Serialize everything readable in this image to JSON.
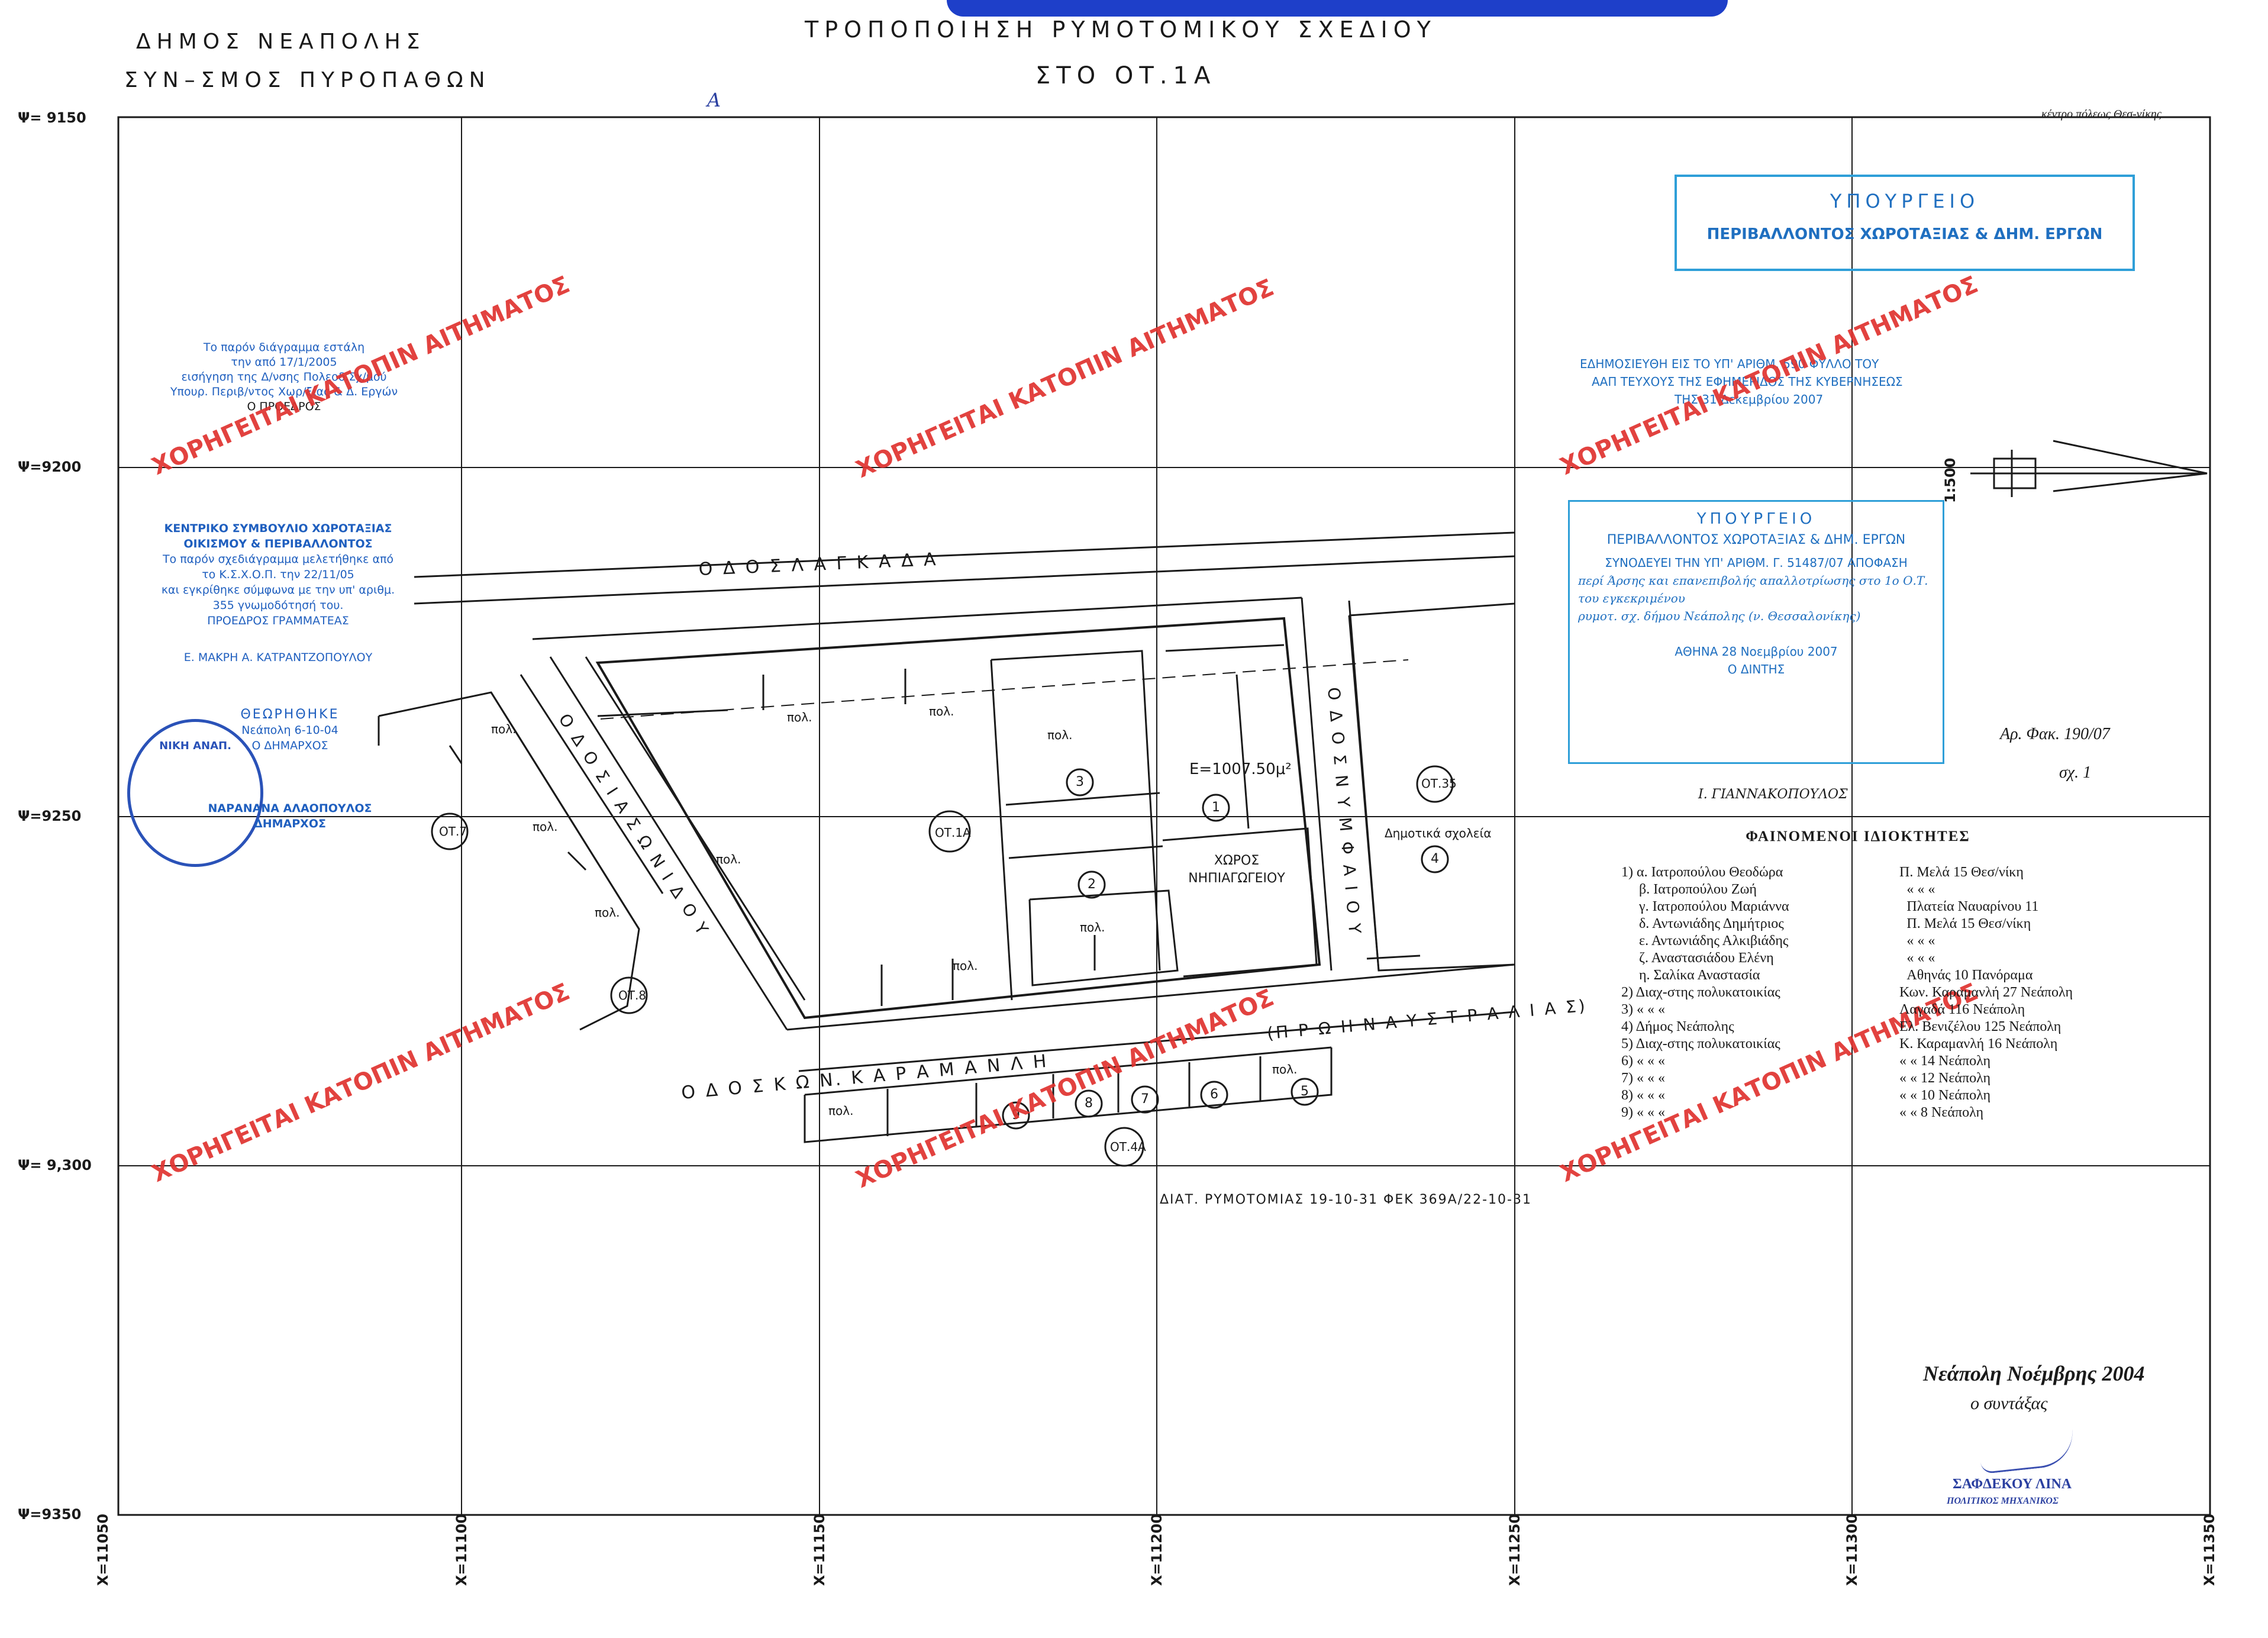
{
  "header": {
    "municipality_line1": "ΔΗΜΟΣ ΝΕΑΠΟΛΗΣ",
    "municipality_line2": "ΣΥΝ–ΣΜΟΣ ΠΥΡΟΠΑΘΩΝ",
    "title_line1": "ΤΡΟΠΟΠΟΙΗΣΗ ΡΥΜΟΤΟΜΙΚΟΥ ΣΧΕΔΙΟΥ",
    "title_line2": "ΣΤΟ ΟΤ.1Α",
    "handwritten_mark": "Α",
    "top_right_note": "κέντρο πόλεως Θεσ-νίκης"
  },
  "grid": {
    "y_labels": [
      "Ψ= 9150",
      "Ψ=9200",
      "Ψ=9250",
      "Ψ= 9,300",
      "Ψ=9350"
    ],
    "x_labels": [
      "Χ=11050",
      "Χ=11100",
      "Χ=11150",
      "Χ=11200",
      "Χ=11250",
      "Χ=11300",
      "Χ=11350"
    ],
    "scale": "1:500"
  },
  "map": {
    "streets": {
      "lagkada": "Ο Δ Ο Σ   Λ Α Γ Κ Α Δ Α",
      "iasonidou": "Ο Δ Ο Σ   Ι Α Σ Ω Ν Ι Δ Ο Υ",
      "nymfaiou": "Ο Δ Ο Σ   Ν Υ Μ Φ Α Ι Ο Υ",
      "karamanli": "Ο Δ Ο Σ   Κ Ω Ν.   Κ Α Ρ Α Μ Α Ν Λ Η",
      "former": "(Π Ρ Ω Η Ν   Α Υ Σ Τ Ρ Α Λ Ι Α Σ)"
    },
    "block_labels": [
      "ΟΤ.1Α",
      "ΟΤ.7",
      "ΟΤ.8",
      "ΟΤ.35",
      "ΟΤ.4Α"
    ],
    "pol": "πολ.",
    "area": "Ε=1007.50μ²",
    "kindergarten": "ΧΩΡΟΣ ΝΗΠΙΑΓΩΓΕΙΟΥ",
    "schools": "Δημοτικά σχολεία",
    "parcel_numbers": [
      "1",
      "2",
      "3",
      "4",
      "5",
      "6",
      "7",
      "8",
      "9"
    ],
    "diat_note": "ΔΙΑΤ. ΡΥΜΟΤΟΜΙΑΣ 19-10-31 ΦΕΚ 369Α/22-10-31"
  },
  "stamps": {
    "ministry_top": {
      "line1": "ΥΠΟΥΡΓΕΙΟ",
      "line2": "ΠΕΡΙΒΑΛΛΟΝΤΟΣ ΧΩΡΟΤΑΞΙΑΣ & ΔΗΜ. ΕΡΓΩΝ"
    },
    "ministry_mid": {
      "line1": "ΥΠΟΥΡΓΕΙΟ",
      "line2": "ΠΕΡΙΒΑΛΛΟΝΤΟΣ ΧΩΡΟΤΑΞΙΑΣ & ΔΗΜ. ΕΡΓΩΝ",
      "line3": "ΣΥΝΟΔΕΥΕΙ ΤΗΝ ΥΠ' ΑΡΙΘΜ. Γ. 51487/07 ΑΠΟΦΑΣΗ",
      "line4": "περί Άρσης και επανεπιβολής απαλλοτρίωσης στο 1ο Ο.Τ. του εγκεκριμένου",
      "line5": "ρυμοτ. σχ. δήμου Νεάπολης (ν. Θεσσαλονίκης)",
      "line6": "ΑΘΗΝΑ  28  Νοεμβρίου  2007",
      "line7": "Ο ΔΙΝΤΗΣ",
      "signer": "Ι. ΓΙΑΝΝΑΚΟΠΟΥΛΟΣ"
    },
    "publication": {
      "line1": "ΕΔΗΜΟΣΙΕΥΘΗ ΕΙΣ ΤΟ ΥΠ' ΑΡΙΘΜ.  590  ΦΥΛΛΟ ΤΟΥ",
      "line2": "ΑΑΠ  ΤΕΥΧΟΥΣ ΤΗΣ ΕΦΗΜΕΡΙΔΟΣ ΤΗΣ ΚΥΒΕΡΝΗΣΕΩΣ",
      "line3": "ΤΗΣ 31 Δεκεμβρίου 2007"
    },
    "file_ref": {
      "line1": "Αρ. Φακ. 190/07",
      "line2": "σχ. 1"
    },
    "council": {
      "line1": "ΚΕΝΤΡΙΚΟ ΣΥΜΒΟΥΛΙΟ ΧΩΡΟΤΑΞΙΑΣ",
      "line2": "ΟΙΚΙΣΜΟΥ & ΠΕΡΙΒΑΛΛΟΝΤΟΣ",
      "line3": "Το παρόν σχεδιάγραμμα μελετήθηκε από",
      "line4": "το Κ.Σ.Χ.Ο.Π. την 22/11/05",
      "line5": "και εγκρίθηκε σύμφωνα με την υπ' αριθμ.",
      "line6": "355 γνωμοδότησή του.",
      "line7": "ΠΡΟΕΔΡΟΣ          ΓΡΑΜΜΑΤΕΑΣ",
      "line8": "Ε. ΜΑΚΡΗ      Α. ΚΑΤΡΑΝΤΖΟΠΟΥΛΟΥ"
    },
    "proposal": {
      "line1": "Το παρόν διάγραμμα εστάλη",
      "line2": "την από 17/1/2005",
      "line3": "εισήγηση της Δ/νσης Πολεοδ.Σχ/μού",
      "line4": "Υπουρ. Περιβ/ντος Χωρ/ξίας & Δ. Εργών",
      "line5": "Ο ΠΡΟΕΔΡΟΣ"
    },
    "mayor": {
      "line1": "ΝΙΚΗ ΑΝΑΠ.",
      "line2": "ΘΕΩΡΗΘΗΚΕ",
      "line3": "Νεάπολη 6-10-04",
      "line4": "Ο ΔΗΜΑΡΧΟΣ",
      "line5": "ΝΑΡΑΝΑΝΑ ΑΛΑΟΠΟΥΛΟΣ",
      "line6": "ΔΗΜΑΡΧΟΣ"
    }
  },
  "watermark": "ΧΟΡΗΓΕΙΤΑΙ ΚΑΤΟΠΙΝ ΑΙΤΗΜΑΤΟΣ",
  "owners": {
    "title": "ΦΑΙΝΟΜΕΝΟΙ   ΙΔΙΟΚΤΗΤΕΣ",
    "rows": [
      {
        "name": "1) α. Ιατροπούλου Θεοδώρα",
        "addr": "Π. Μελά 15 Θεσ/νίκη"
      },
      {
        "name": "β. Ιατροπούλου Ζωή",
        "addr": "«      «      «"
      },
      {
        "name": "γ. Ιατροπούλου Μαριάννα",
        "addr": "Πλατεία Ναυαρίνου 11"
      },
      {
        "name": "δ. Αντωνιάδης Δημήτριος",
        "addr": "Π. Μελά 15 Θεσ/νίκη"
      },
      {
        "name": "ε. Αντωνιάδης Αλκιβιάδης",
        "addr": "«      «      «"
      },
      {
        "name": "ζ. Αναστασιάδου Ελένη",
        "addr": "«      «      «"
      },
      {
        "name": "η. Σαλίκα Αναστασία",
        "addr": "Αθηνάς 10 Πανόραμα"
      },
      {
        "name": "2)  Διαχ-στης πολυκατοικίας",
        "addr": "Κων. Καραμανλή 27 Νεάπολη"
      },
      {
        "name": "3)   «      «      «",
        "addr": "Λαγαδά       116 Νεάπολη"
      },
      {
        "name": "4)  Δήμος Νεάπολης",
        "addr": "Ελ. Βενιζέλου 125 Νεάπολη"
      },
      {
        "name": "5)  Διαχ-στης πολυκατοικίας",
        "addr": "Κ. Καραμανλή 16 Νεάπολη"
      },
      {
        "name": "6)   «      «      «",
        "addr": "«      «      14 Νεάπολη"
      },
      {
        "name": "7)   «      «      «",
        "addr": "«      «      12 Νεάπολη"
      },
      {
        "name": "8)   «      «      «",
        "addr": "«      «      10 Νεάπολη"
      },
      {
        "name": "9)   «      «      «",
        "addr": "«      «       8 Νεάπολη"
      }
    ]
  },
  "signature": {
    "place_date": "Νεάπολη Νοέμβρης 2004",
    "role": "ο συντάξας",
    "name": "ΣΑΦΔΕΚΟΥ ΛΙΝΑ",
    "title": "ΠΟΛΙΤΙΚΟΣ ΜΗΧΑΝΙΚΟΣ"
  },
  "colors": {
    "stamp_blue": "#2f9fd8",
    "watermark_red": "#e0332f",
    "ink": "#1a1a1a"
  }
}
